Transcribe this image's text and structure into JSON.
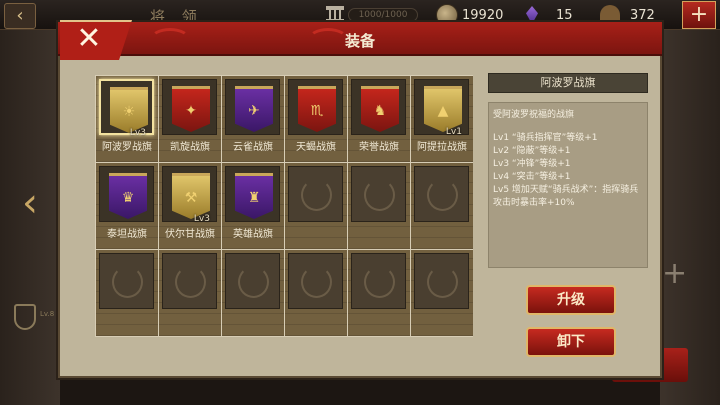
{
  "hud": {
    "title": "将 领",
    "building_bar": "1000/1000",
    "coins": "19920",
    "gems": "15",
    "soldiers": "372",
    "add_label": "+"
  },
  "panel": {
    "title": "装备",
    "close_label": "✕"
  },
  "banners": [
    {
      "name": "阿波罗战旗",
      "color": "gold",
      "emblem": "☀",
      "level": "Lv3",
      "selected": true
    },
    {
      "name": "凯旋战旗",
      "color": "red",
      "emblem": "✦",
      "level": "",
      "selected": false
    },
    {
      "name": "云雀战旗",
      "color": "purple",
      "emblem": "✈",
      "level": "",
      "selected": false
    },
    {
      "name": "天蝎战旗",
      "color": "red",
      "emblem": "♏",
      "level": "",
      "selected": false
    },
    {
      "name": "荣誉战旗",
      "color": "red",
      "emblem": "♞",
      "level": "",
      "selected": false
    },
    {
      "name": "阿提拉战旗",
      "color": "gold",
      "emblem": "▲",
      "level": "Lv1",
      "selected": false
    },
    {
      "name": "泰坦战旗",
      "color": "purple",
      "emblem": "♛",
      "level": "",
      "selected": false
    },
    {
      "name": "伏尔甘战旗",
      "color": "gold",
      "emblem": "⚒",
      "level": "Lv3",
      "selected": false
    },
    {
      "name": "英雄战旗",
      "color": "purple",
      "emblem": "♜",
      "level": "",
      "selected": false
    }
  ],
  "detail": {
    "title": "阿波罗战旗",
    "description": "受阿波罗祝福的战旗",
    "lines": [
      "Lv1 “骑兵指挥官”等级+1",
      "Lv2 “隐蔽”等级+1",
      "Lv3 “冲锋”等级+1",
      "Lv4 “突击”等级+1",
      "Lv5 增加天赋“骑兵战术”：指挥骑兵攻击时暴击率+10%"
    ]
  },
  "actions": {
    "upgrade_label": "升级",
    "unequip_label": "卸下"
  },
  "background": {
    "left_badge": "Lv.8"
  },
  "colors": {
    "accent_red": "#b01f17",
    "panel": "#bfb59b",
    "gold_border": "#e0b668"
  }
}
